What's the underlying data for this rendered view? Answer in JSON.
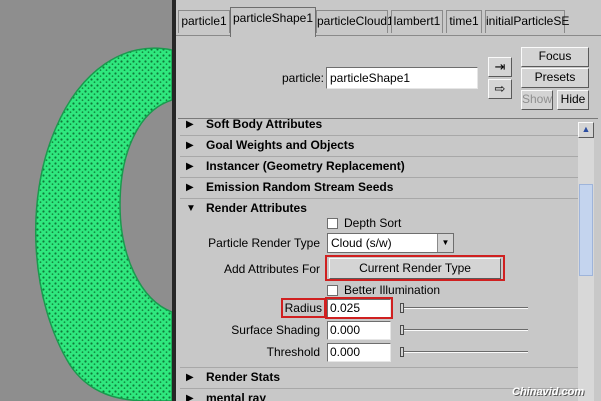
{
  "tabs": [
    {
      "label": "particle1"
    },
    {
      "label": "particleShape1"
    },
    {
      "label": "particleCloud1"
    },
    {
      "label": "lambert1"
    },
    {
      "label": "time1"
    },
    {
      "label": "initialParticleSE"
    }
  ],
  "header": {
    "particle_label": "particle:",
    "particle_value": "particleShape1",
    "focus_label": "Focus",
    "presets_label": "Presets",
    "show_label": "Show",
    "hide_label": "Hide"
  },
  "sections": [
    {
      "title": "Soft Body Attributes",
      "expanded": false
    },
    {
      "title": "Goal Weights and Objects",
      "expanded": false
    },
    {
      "title": "Instancer (Geometry Replacement)",
      "expanded": false
    },
    {
      "title": "Emission Random Stream Seeds",
      "expanded": false
    },
    {
      "title": "Render Attributes",
      "expanded": true
    },
    {
      "title": "Render Stats",
      "expanded": false
    },
    {
      "title": "mental ray",
      "expanded": false
    }
  ],
  "render": {
    "depth_sort_label": "Depth Sort",
    "particle_render_type_label": "Particle Render Type",
    "particle_render_type_value": "Cloud (s/w)",
    "add_attributes_label": "Add Attributes For",
    "current_render_type_label": "Current Render Type",
    "better_illumination_label": "Better Illumination",
    "radius_label": "Radius",
    "radius_value": "0.025",
    "surface_shading_label": "Surface Shading",
    "surface_shading_value": "0.000",
    "threshold_label": "Threshold",
    "threshold_value": "0.000",
    "slider_levels": {
      "radius": 0.0,
      "surface_shading": 0.0,
      "threshold": 0.0
    }
  },
  "watermark": "Chinavid.com",
  "colors": {
    "particle_fill": "#2fe87e",
    "highlight_box": "#d02020",
    "viewport_bg": "#8e8e8e",
    "panel_bg": "#c8c8c8"
  }
}
